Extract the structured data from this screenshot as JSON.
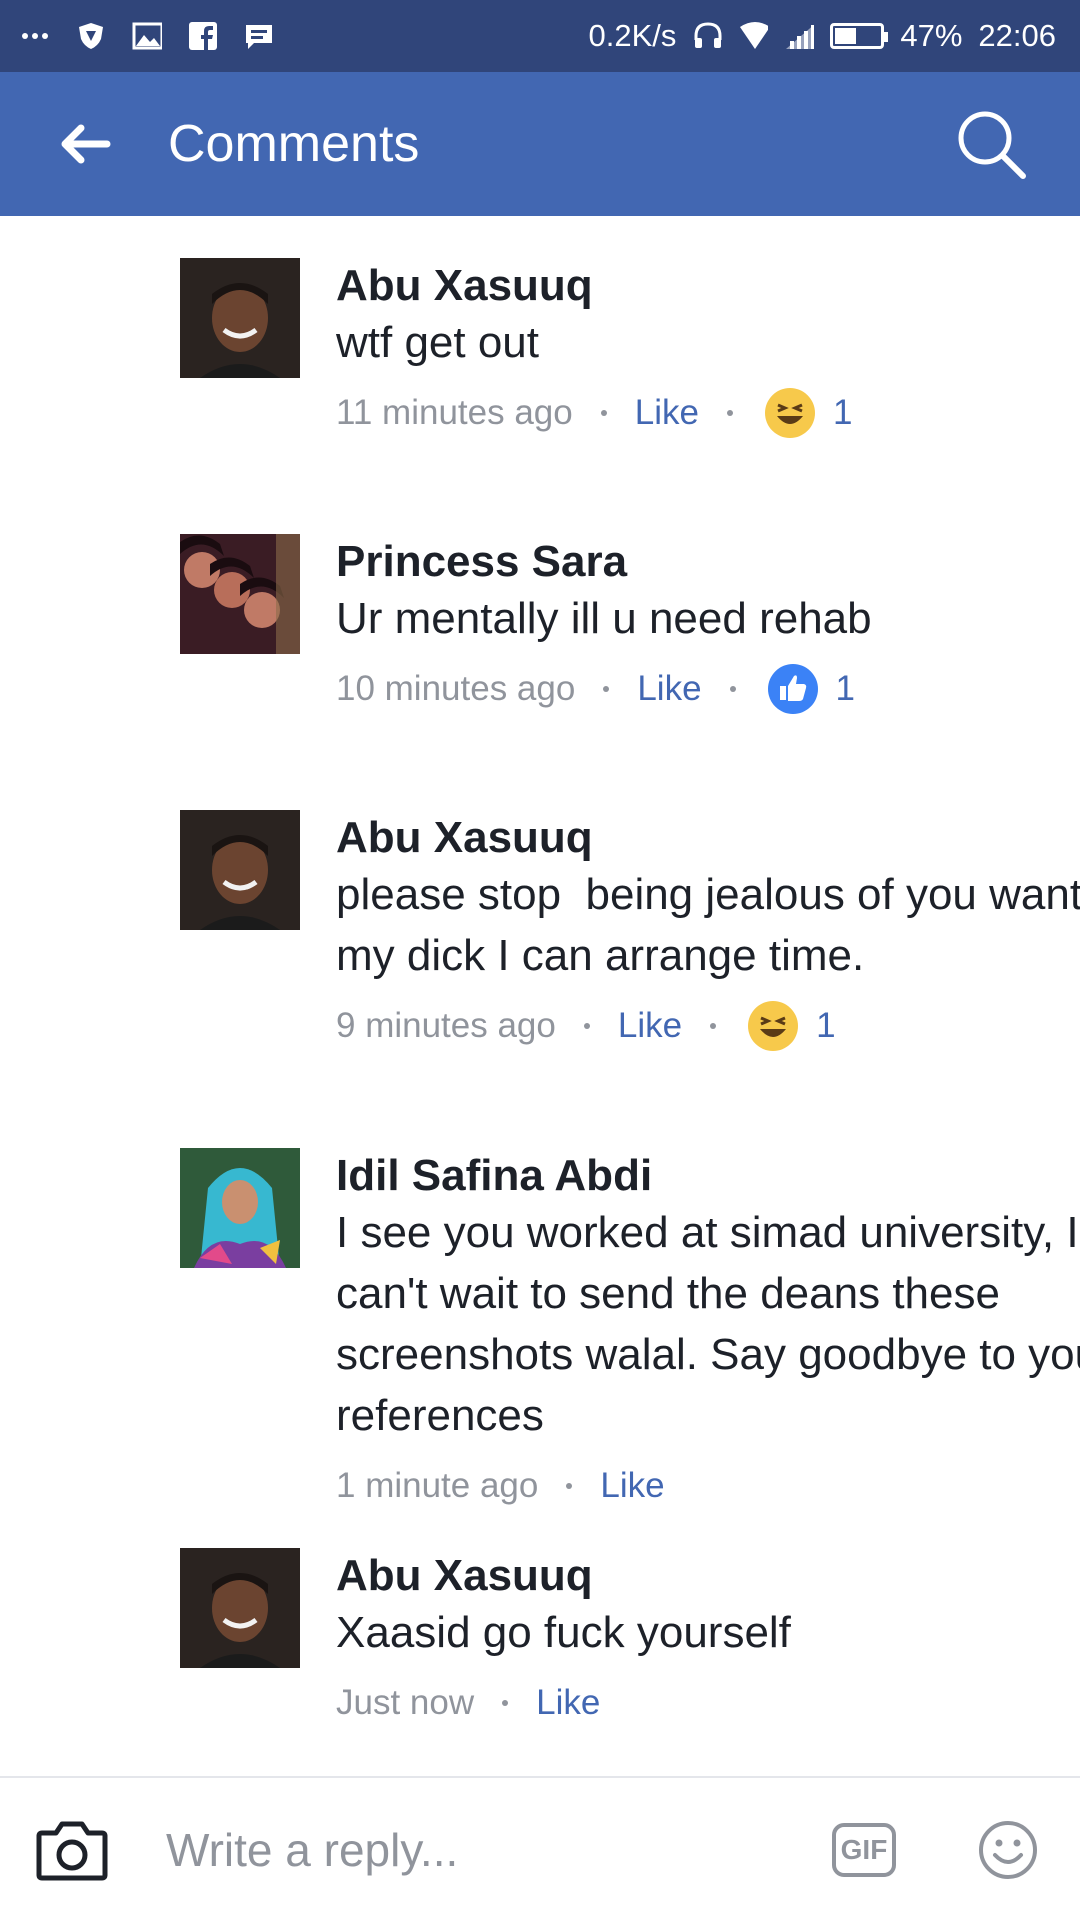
{
  "status_bar": {
    "net_speed": "0.2K/s",
    "battery": "47%",
    "battery_level": 0.47,
    "time": "22:06"
  },
  "app_bar": {
    "title": "Comments"
  },
  "comments": [
    {
      "author": "Abu Xasuuq",
      "text": "wtf get out",
      "time": "11 minutes ago",
      "like_label": "Like",
      "reaction": "haha-icon",
      "reaction_count": "1"
    },
    {
      "author": "Princess Sara",
      "text": "Ur mentally ill u need rehab",
      "time": "10 minutes ago",
      "like_label": "Like",
      "reaction": "like-icon",
      "reaction_count": "1"
    },
    {
      "author": "Abu Xasuuq",
      "text": "please stop  being jealous of you want my dick I can arrange time.",
      "time": "9 minutes ago",
      "like_label": "Like",
      "reaction": "haha-icon",
      "reaction_count": "1"
    },
    {
      "author": "Idil Safina Abdi",
      "text": "I see you worked at simad university, I can't wait to send the deans these screenshots walal. Say goodbye to your references",
      "time": "1 minute ago",
      "like_label": "Like"
    },
    {
      "author": "Abu Xasuuq",
      "text": "Xaasid go fuck yourself",
      "time": "Just now",
      "like_label": "Like"
    }
  ],
  "composer": {
    "placeholder": "Write a reply...",
    "gif_label": "GIF"
  },
  "colors": {
    "status_bar": "#30457a",
    "app_bar": "#4267b2",
    "link": "#4267b2",
    "muted": "#90949c"
  }
}
